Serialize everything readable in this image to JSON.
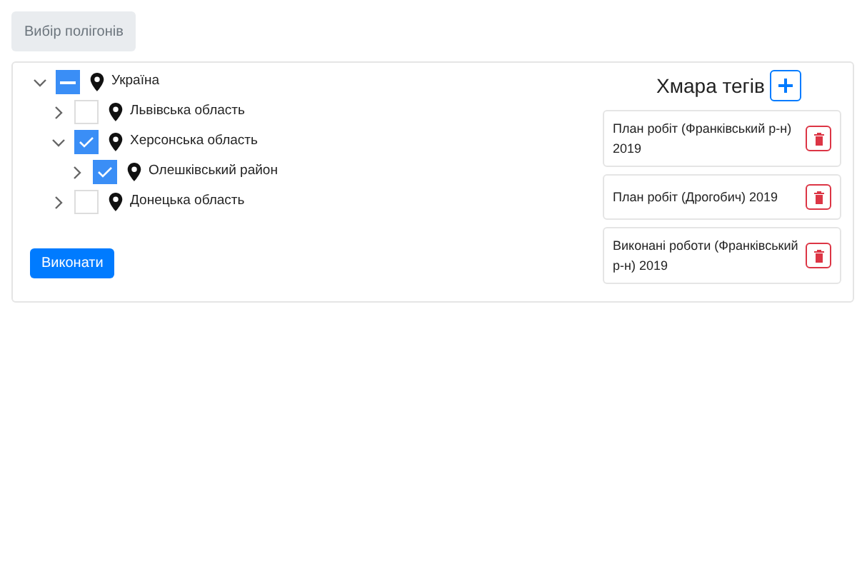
{
  "top_button": "Вибір полігонів",
  "tree": [
    {
      "label": "Україна",
      "expanded": true,
      "checked": false,
      "indeterminate": true,
      "children": [
        {
          "label": "Львівська область",
          "expanded": false,
          "checked": false,
          "indeterminate": false
        },
        {
          "label": "Херсонська область",
          "expanded": true,
          "checked": true,
          "indeterminate": false,
          "children": [
            {
              "label": "Олешківський район",
              "expanded": false,
              "checked": true,
              "indeterminate": false
            }
          ]
        },
        {
          "label": "Донецька область",
          "expanded": false,
          "checked": false,
          "indeterminate": false
        }
      ]
    }
  ],
  "run_button": "Виконати",
  "tag_cloud": {
    "title": "Хмара тегів",
    "tags": [
      {
        "label": "План робіт (Франківський р-н) 2019"
      },
      {
        "label": "План робіт (Дрогобич) 2019"
      },
      {
        "label": "Виконані роботи (Франківський р-н) 2019"
      }
    ]
  }
}
